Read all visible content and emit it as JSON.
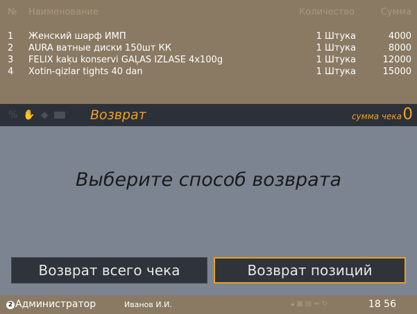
{
  "receipt": {
    "headers": {
      "no": "№",
      "name": "Наименование",
      "qty": "Количество",
      "sum": "Сумма"
    },
    "rows": [
      {
        "no": "1",
        "name": "Женский шарф ИМП",
        "qty": "1 Штука",
        "sum": "4000"
      },
      {
        "no": "2",
        "name": "AURA ватные диски 150шт КК",
        "qty": "1 Штука",
        "sum": "8000"
      },
      {
        "no": "3",
        "name": "FELIX kaķu konservi GAĻAS IZLASE 4x100g",
        "qty": "1 Штука",
        "sum": "12000"
      },
      {
        "no": "4",
        "name": "Xotin-qizlar tights 40 dan",
        "qty": "1 Штука",
        "sum": "15000"
      }
    ]
  },
  "statusbar": {
    "icons": [
      "percent-icon",
      "hand-icon",
      "tag-icon",
      "card-icon"
    ],
    "title": "Возврат",
    "total_label": "сумма чека",
    "total_value": "0"
  },
  "main": {
    "prompt": "Выберите способ возврата",
    "buttons": {
      "full_return": "Возврат всего чека",
      "item_return": "Возврат позиций"
    }
  },
  "footer": {
    "badge": "2",
    "role": "Администратор",
    "user": "Иванов И.И.",
    "icons": [
      "lock-icon",
      "keyboard-icon",
      "printer-icon",
      "network-icon",
      "sync-icon"
    ],
    "time": "18 56"
  },
  "colors": {
    "accent": "#f0a020",
    "receipt_bg": "#8a7a63",
    "main_bg": "#7d8491",
    "statusbar_bg": "#2c3038"
  }
}
